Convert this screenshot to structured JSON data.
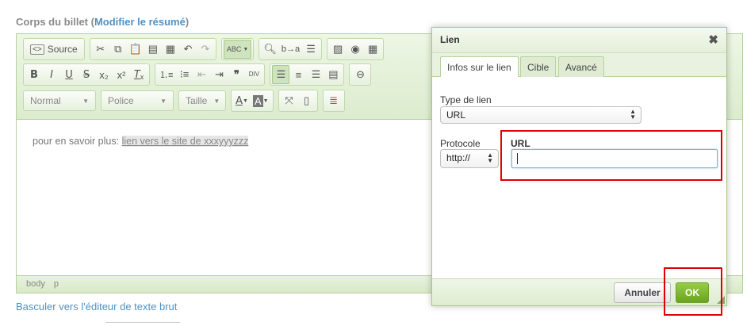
{
  "header": {
    "title": "Corps du billet",
    "edit_summary_link": "Modifier le résumé"
  },
  "toolbar": {
    "source_label": "Source",
    "format_combo": "Normal",
    "font_combo": "Police",
    "size_combo": "Taille",
    "spell_label": "ABC",
    "div_label": "DIV"
  },
  "content": {
    "text_prefix": "pour en savoir plus:",
    "link_text": "lien vers le site de xxxyyyzzz"
  },
  "statusbar": {
    "path": [
      "body",
      "p"
    ]
  },
  "bottom_link": "Basculer vers l'éditeur de texte brut",
  "dialog": {
    "title": "Lien",
    "close_symbol": "✖",
    "tabs": [
      {
        "label": "Infos sur le lien",
        "active": true
      },
      {
        "label": "Cible",
        "active": false
      },
      {
        "label": "Avancé",
        "active": false
      }
    ],
    "link_type_label": "Type de lien",
    "link_type_value": "URL",
    "protocol_label": "Protocole",
    "protocol_value": "http://",
    "url_label": "URL",
    "url_value": "",
    "cancel_button": "Annuler",
    "ok_button": "OK"
  },
  "colors": {
    "accent_green": "#6aa420",
    "highlight_red": "#e00000",
    "link_blue": "#4f91c4"
  }
}
